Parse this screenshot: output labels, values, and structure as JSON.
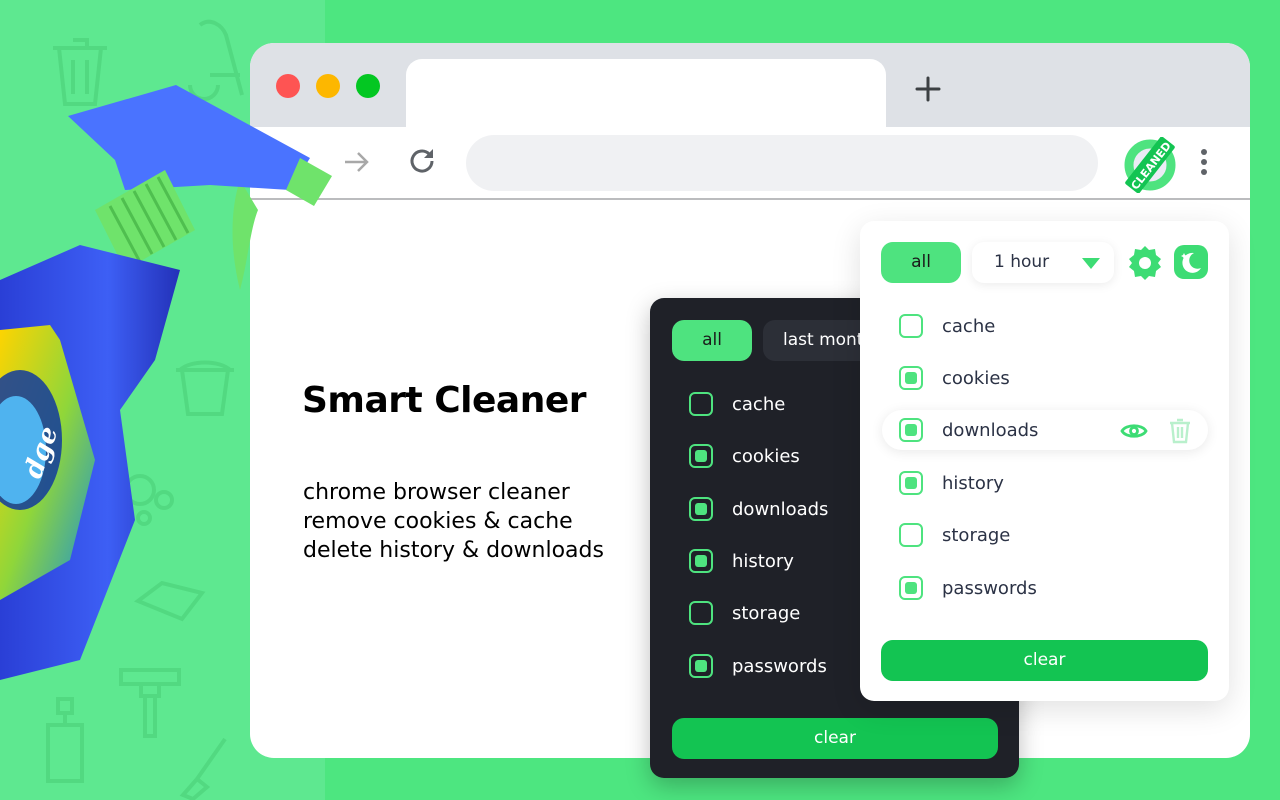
{
  "browser": {
    "new_tab_icon": "plus-icon",
    "forward_icon": "arrow-right-icon",
    "reload_icon": "reload-icon",
    "omnibox_value": "",
    "extension_badge": "CLEANED",
    "menu_icon": "vertical-dots-icon"
  },
  "hero": {
    "title": "Smart Cleaner",
    "lines": [
      "chrome browser cleaner",
      "remove cookies & cache",
      "delete history & downloads"
    ]
  },
  "dark_popup": {
    "all_label": "all",
    "range_label": "last month",
    "items": [
      {
        "label": "cache",
        "checked": false
      },
      {
        "label": "cookies",
        "checked": true
      },
      {
        "label": "downloads",
        "checked": true
      },
      {
        "label": "history",
        "checked": true
      },
      {
        "label": "storage",
        "checked": false
      },
      {
        "label": "passwords",
        "checked": true
      }
    ],
    "clear_label": "clear"
  },
  "light_popup": {
    "all_label": "all",
    "range_value": "1 hour",
    "settings_icon": "gear-icon",
    "theme_icon": "moon-icon",
    "items": [
      {
        "label": "cache",
        "checked": false
      },
      {
        "label": "cookies",
        "checked": true
      },
      {
        "label": "downloads",
        "checked": true,
        "hovered": true
      },
      {
        "label": "history",
        "checked": true
      },
      {
        "label": "storage",
        "checked": false
      },
      {
        "label": "passwords",
        "checked": true
      }
    ],
    "row_actions": [
      "eye-icon",
      "trash-icon"
    ],
    "clear_label": "clear"
  },
  "colors": {
    "background": "#4de680",
    "accent": "#4ee37f",
    "button": "#13c452",
    "dark_panel": "#1f2128"
  }
}
